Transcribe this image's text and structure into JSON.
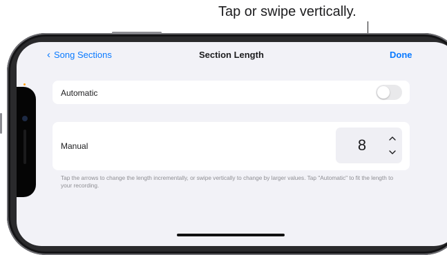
{
  "callout": {
    "text": "Tap or swipe vertically."
  },
  "nav": {
    "back_label": "Song Sections",
    "title": "Section Length",
    "done_label": "Done"
  },
  "automatic": {
    "label": "Automatic",
    "enabled": false
  },
  "manual": {
    "label": "Manual",
    "value": "8"
  },
  "hint": "Tap the arrows to change the length incrementally, or swipe vertically to change by larger values. Tap \"Automatic\" to fit the length to your recording.",
  "icons": {
    "back": "chevron-left-icon",
    "up": "chevron-up-icon",
    "down": "chevron-down-icon"
  },
  "colors": {
    "accent": "#0a7aff",
    "background": "#f2f2f7",
    "toggle_off": "#e9e9eb"
  }
}
